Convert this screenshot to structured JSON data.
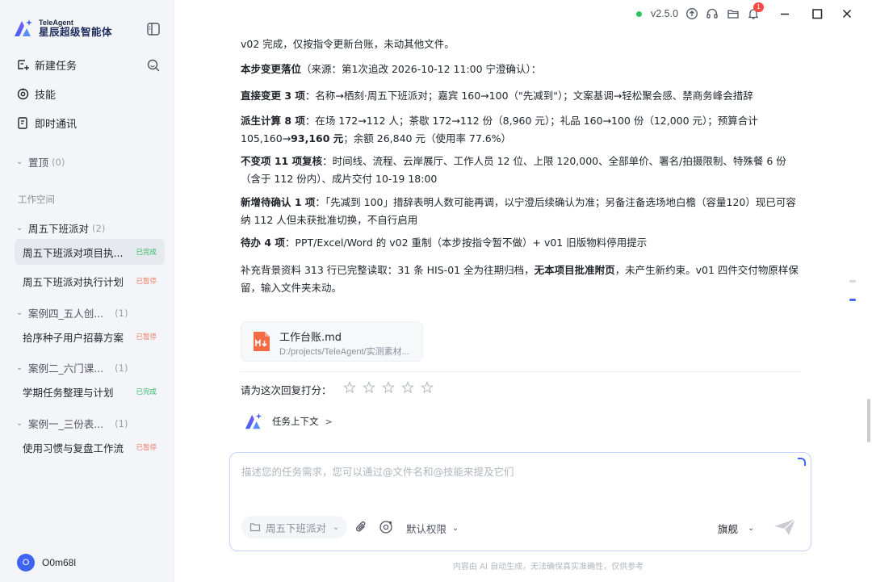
{
  "app": {
    "logo_en": "TeleAgent",
    "logo_cn": "星辰超级智能体",
    "version": "v2.5.0",
    "notification_count": "1",
    "status_color": "#2fc25b",
    "accent": "#3f63f2"
  },
  "sidebar": {
    "nav": [
      {
        "label": "新建任务",
        "icon": "new-task-icon"
      },
      {
        "label": "技能",
        "icon": "skill-icon"
      },
      {
        "label": "即时通讯",
        "icon": "im-icon"
      }
    ],
    "pinned": {
      "label": "置顶",
      "count": "(0)"
    },
    "workspace_label": "工作空间",
    "groups": [
      {
        "label": "周五下班派对",
        "count": "(2)",
        "tasks": [
          {
            "title": "周五下班派对项目执...",
            "status": "已完成"
          },
          {
            "title": "周五下班派对执行计划",
            "status": "已暂停"
          }
        ]
      },
      {
        "label": "案例四_五人创...",
        "count": "(1)",
        "tasks": [
          {
            "title": "拾序种子用户招募方案",
            "status": "已暂停"
          }
        ]
      },
      {
        "label": "案例二_六门课...",
        "count": "(1)",
        "tasks": [
          {
            "title": "学期任务整理与计划",
            "status": "已完成"
          }
        ]
      },
      {
        "label": "案例一_三份表...",
        "count": "(1)",
        "tasks": [
          {
            "title": "使用习惯与复盘工作流",
            "status": "已暂停"
          }
        ]
      }
    ],
    "user": {
      "initial": "O",
      "name": "O0m68l"
    }
  },
  "message": {
    "p0": "v02 完成，仅按指令更新台账，未动其他文件。",
    "p1_bold": "本步变更落位",
    "p1_rest": "（来源：第1次追改 2026-10-12 11:00 宁澄确认）：",
    "p2_bold": "直接变更 3 项",
    "p2_rest": "：名称→栖刻·周五下班派对；嘉宾 160→100（\"先减到\"）；文案基调→轻松聚会感、禁商务峰会措辞",
    "p3_bold": "派生计算 8 项",
    "p3_rest1": "：在场 172→112 人；茶歇 172→112 份（8,960 元）；礼品 160→100 份（12,000 元）；预算合计 105,160→",
    "p3_bold2": "93,160 元",
    "p3_rest2": "；余额 26,840 元（使用率 77.6%）",
    "p4_bold": "不变项 11 项复核",
    "p4_rest": "：时间线、流程、云岸展厅、工作人员 12 位、上限 120,000、全部单价、署名/拍摄限制、特殊餐 6 份（含于 112 份内）、成片交付 10-19 18:00",
    "p5_bold": "新增待确认 1 项",
    "p5_rest": "：「先减到 100」措辞表明人数可能再调，以宁澄后续确认为准；另备注备选场地白檐（容量120）现已可容纳 112 人但未获批准切换，不自行启用",
    "p6_bold": "待办 4 项",
    "p6_rest": "：PPT/Excel/Word 的 v02 重制（本步按指令暂不做）+ v01 旧版物料停用提示",
    "p7_a": "补充背景资料 313 行已完整读取：31 条 HIS-01 全为往期归档，",
    "p7_bold": "无本项目批准附页",
    "p7_b": "，未产生新约束。v01 四件交付物原样保留，输入文件夹未动。"
  },
  "file": {
    "name": "工作台账.md",
    "path": "D:/projects/TeleAgent/实测素材..."
  },
  "rating": {
    "label": "请为这次回复打分：",
    "stars": 5
  },
  "context": {
    "label": "任务上下文",
    "arrow": ">"
  },
  "input": {
    "placeholder": "描述您的任务需求，您可以通过@文件名和@技能来提及它们",
    "folder_chip": "周五下班派对",
    "permission": "默认权限",
    "model": "旗舰"
  },
  "footer": "内容由 AI 自动生成，无法确保真实准确性，仅供参考"
}
